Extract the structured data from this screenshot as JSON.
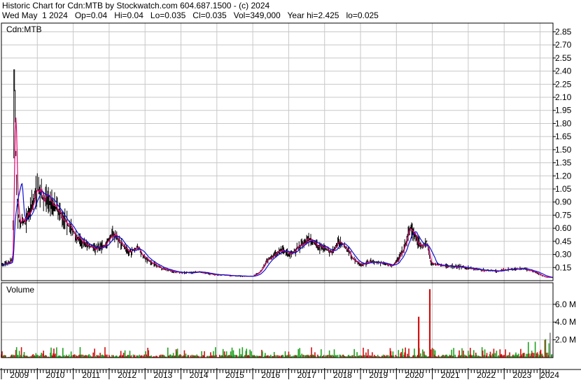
{
  "header": {
    "title_line": "Historic Chart for Cdn:MTB by Stockwatch.com 604.687.1500 - (c) 2024",
    "quote_line": "Wed May  1 2024   Op=0.04   Hi=0.04   Lo=0.035   Cl=0.035   Vol=349,000   Year hi=2.425   lo=0.025"
  },
  "price_panel": {
    "label": "Cdn:MTB"
  },
  "volume_panel": {
    "label": "Volume"
  },
  "colors": {
    "grid": "#c8c8c8",
    "price_bars": "#000000",
    "ma_short": "#e0006e",
    "ma_long": "#1010d0",
    "volume_up": "#20a020",
    "volume_down": "#d01010"
  },
  "chart_data": [
    {
      "type": "line",
      "title": "",
      "ylabel": "",
      "ylim": [
        0,
        2.95
      ],
      "y_ticks": [
        "0.15",
        "0.30",
        "0.45",
        "0.60",
        "0.75",
        "0.90",
        "1.05",
        "1.20",
        "1.35",
        "1.50",
        "1.65",
        "1.80",
        "1.95",
        "2.10",
        "2.25",
        "2.40",
        "2.55",
        "2.70",
        "2.85"
      ],
      "x_tick_labels": [
        "2009",
        "2010",
        "2011",
        "2012",
        "2013",
        "2014",
        "2015",
        "2016",
        "2017",
        "2018",
        "2019",
        "2020",
        "2021",
        "2022",
        "2023",
        "2024"
      ],
      "series": [
        {
          "x": [
            2009.0,
            2009.2,
            2009.32,
            2009.36,
            2009.4,
            2009.45,
            2009.55,
            2009.7,
            2009.85,
            2010.0,
            2010.15,
            2010.3,
            2010.5,
            2010.7,
            2010.9,
            2011.1,
            2011.3,
            2011.6,
            2011.9,
            2012.1,
            2012.3,
            2012.55,
            2012.8,
            2013.0,
            2013.2,
            2013.5,
            2013.8,
            2014.1,
            2014.5,
            2014.9,
            2015.3,
            2015.7,
            2016.0,
            2016.2,
            2016.4,
            2016.6,
            2016.8,
            2017.0,
            2017.3,
            2017.55,
            2017.8,
            2018.0,
            2018.2,
            2018.4,
            2018.6,
            2018.8,
            2019.0,
            2019.3,
            2019.6,
            2019.9,
            2020.05,
            2020.2,
            2020.4,
            2020.55,
            2020.7,
            2020.85,
            2020.95,
            2021.1,
            2021.4,
            2021.7,
            2022.0,
            2022.4,
            2022.8,
            2023.2,
            2023.5,
            2023.8,
            2024.0,
            2024.15,
            2024.33
          ],
          "values": [
            0.18,
            0.2,
            0.26,
            2.42,
            1.5,
            0.75,
            0.65,
            0.7,
            0.88,
            1.05,
            0.95,
            0.92,
            0.85,
            0.75,
            0.62,
            0.5,
            0.42,
            0.38,
            0.4,
            0.55,
            0.45,
            0.32,
            0.38,
            0.25,
            0.2,
            0.14,
            0.1,
            0.09,
            0.1,
            0.07,
            0.06,
            0.05,
            0.05,
            0.1,
            0.22,
            0.3,
            0.35,
            0.3,
            0.38,
            0.48,
            0.4,
            0.38,
            0.32,
            0.45,
            0.38,
            0.25,
            0.18,
            0.22,
            0.2,
            0.17,
            0.25,
            0.35,
            0.62,
            0.48,
            0.38,
            0.45,
            0.2,
            0.18,
            0.17,
            0.16,
            0.15,
            0.12,
            0.11,
            0.13,
            0.14,
            0.11,
            0.07,
            0.04,
            0.035
          ]
        }
      ]
    },
    {
      "type": "bar",
      "title": "",
      "ylabel": "",
      "ylim": [
        0,
        7.8
      ],
      "y_ticks": [
        "2.0 M",
        "4.0 M",
        "6.0 M"
      ],
      "spikes": [
        {
          "x": 2020.62,
          "value": 4.6
        },
        {
          "x": 2020.93,
          "value": 7.7
        },
        {
          "x": 2024.28,
          "value": 2.8
        }
      ]
    }
  ]
}
